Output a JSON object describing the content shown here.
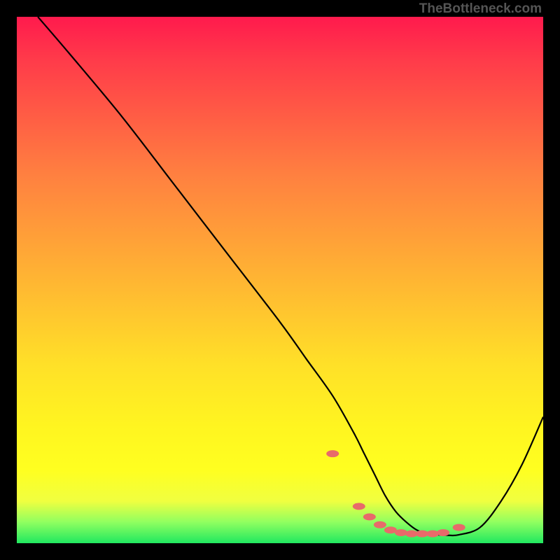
{
  "watermark": "TheBottleneck.com",
  "chart_data": {
    "type": "line",
    "title": "",
    "xlabel": "",
    "ylabel": "",
    "xlim": [
      0,
      100
    ],
    "ylim": [
      0,
      100
    ],
    "curve": {
      "x": [
        4,
        10,
        20,
        30,
        40,
        50,
        55,
        60,
        64,
        66,
        68,
        70,
        72,
        74,
        76,
        78,
        80,
        82,
        84,
        88,
        92,
        96,
        100
      ],
      "y_pct": [
        100,
        93,
        81,
        68,
        55,
        42,
        35,
        28,
        21,
        17,
        13,
        9,
        6,
        4,
        2.5,
        1.8,
        1.6,
        1.5,
        1.6,
        3,
        8,
        15,
        24
      ]
    },
    "markers": {
      "x": [
        60,
        65,
        67,
        69,
        71,
        73,
        75,
        77,
        79,
        81,
        84
      ],
      "y_pct": [
        17,
        7,
        5,
        3.5,
        2.5,
        2,
        1.8,
        1.8,
        1.8,
        2,
        3
      ]
    }
  }
}
